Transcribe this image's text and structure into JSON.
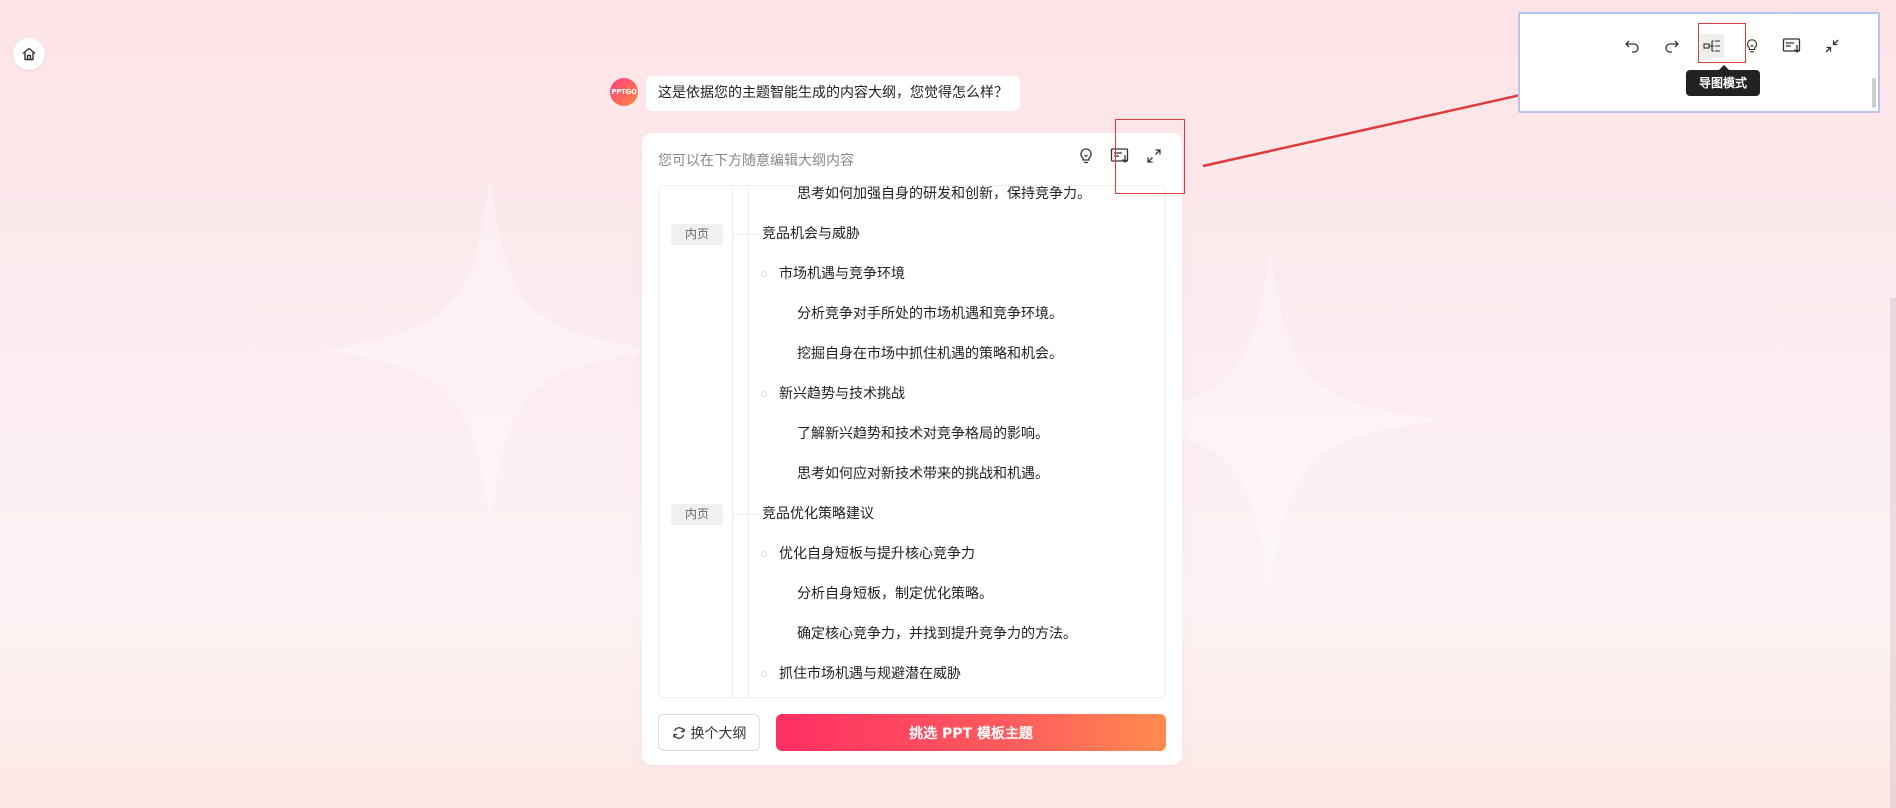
{
  "chat": {
    "avatar_text": "PPTGO",
    "message": "这是依据您的主题智能生成的内容大纲，您觉得怎么样？"
  },
  "panel": {
    "hint": "您可以在下方随意编辑大纲内容",
    "rows": [
      {
        "level": 3,
        "text": "思考如何加强自身的研发和创新，保持竞争力。"
      },
      {
        "level": 1,
        "text": "竞品机会与威胁",
        "badge": "内页"
      },
      {
        "level": 2,
        "text": "市场机遇与竞争环境"
      },
      {
        "level": 3,
        "text": "分析竞争对手所处的市场机遇和竞争环境。"
      },
      {
        "level": 3,
        "text": "挖掘自身在市场中抓住机遇的策略和机会。"
      },
      {
        "level": 2,
        "text": "新兴趋势与技术挑战"
      },
      {
        "level": 3,
        "text": "了解新兴趋势和技术对竞争格局的影响。"
      },
      {
        "level": 3,
        "text": "思考如何应对新技术带来的挑战和机遇。"
      },
      {
        "level": 1,
        "text": "竞品优化策略建议",
        "badge": "内页"
      },
      {
        "level": 2,
        "text": "优化自身短板与提升核心竞争力"
      },
      {
        "level": 3,
        "text": "分析自身短板，制定优化策略。"
      },
      {
        "level": 3,
        "text": "确定核心竞争力，并找到提升竞争力的方法。"
      },
      {
        "level": 2,
        "text": "抓住市场机遇与规避潜在威胁"
      }
    ],
    "change_outline_label": "换个大纲",
    "choose_template_label": "挑选 PPT 模板主题"
  },
  "inset": {
    "tooltip": "导图模式"
  },
  "colors": {
    "accent_start": "#ff2e63",
    "accent_end": "#ff8a4f",
    "annotation_red": "#e23a3a"
  },
  "icons": {
    "home": "home-icon",
    "idea": "lightbulb-icon",
    "export": "list-download-icon",
    "expand": "expand-icon",
    "collapse": "collapse-icon",
    "undo": "undo-icon",
    "redo": "redo-icon",
    "mindmap": "mindmap-icon",
    "refresh": "refresh-icon"
  }
}
